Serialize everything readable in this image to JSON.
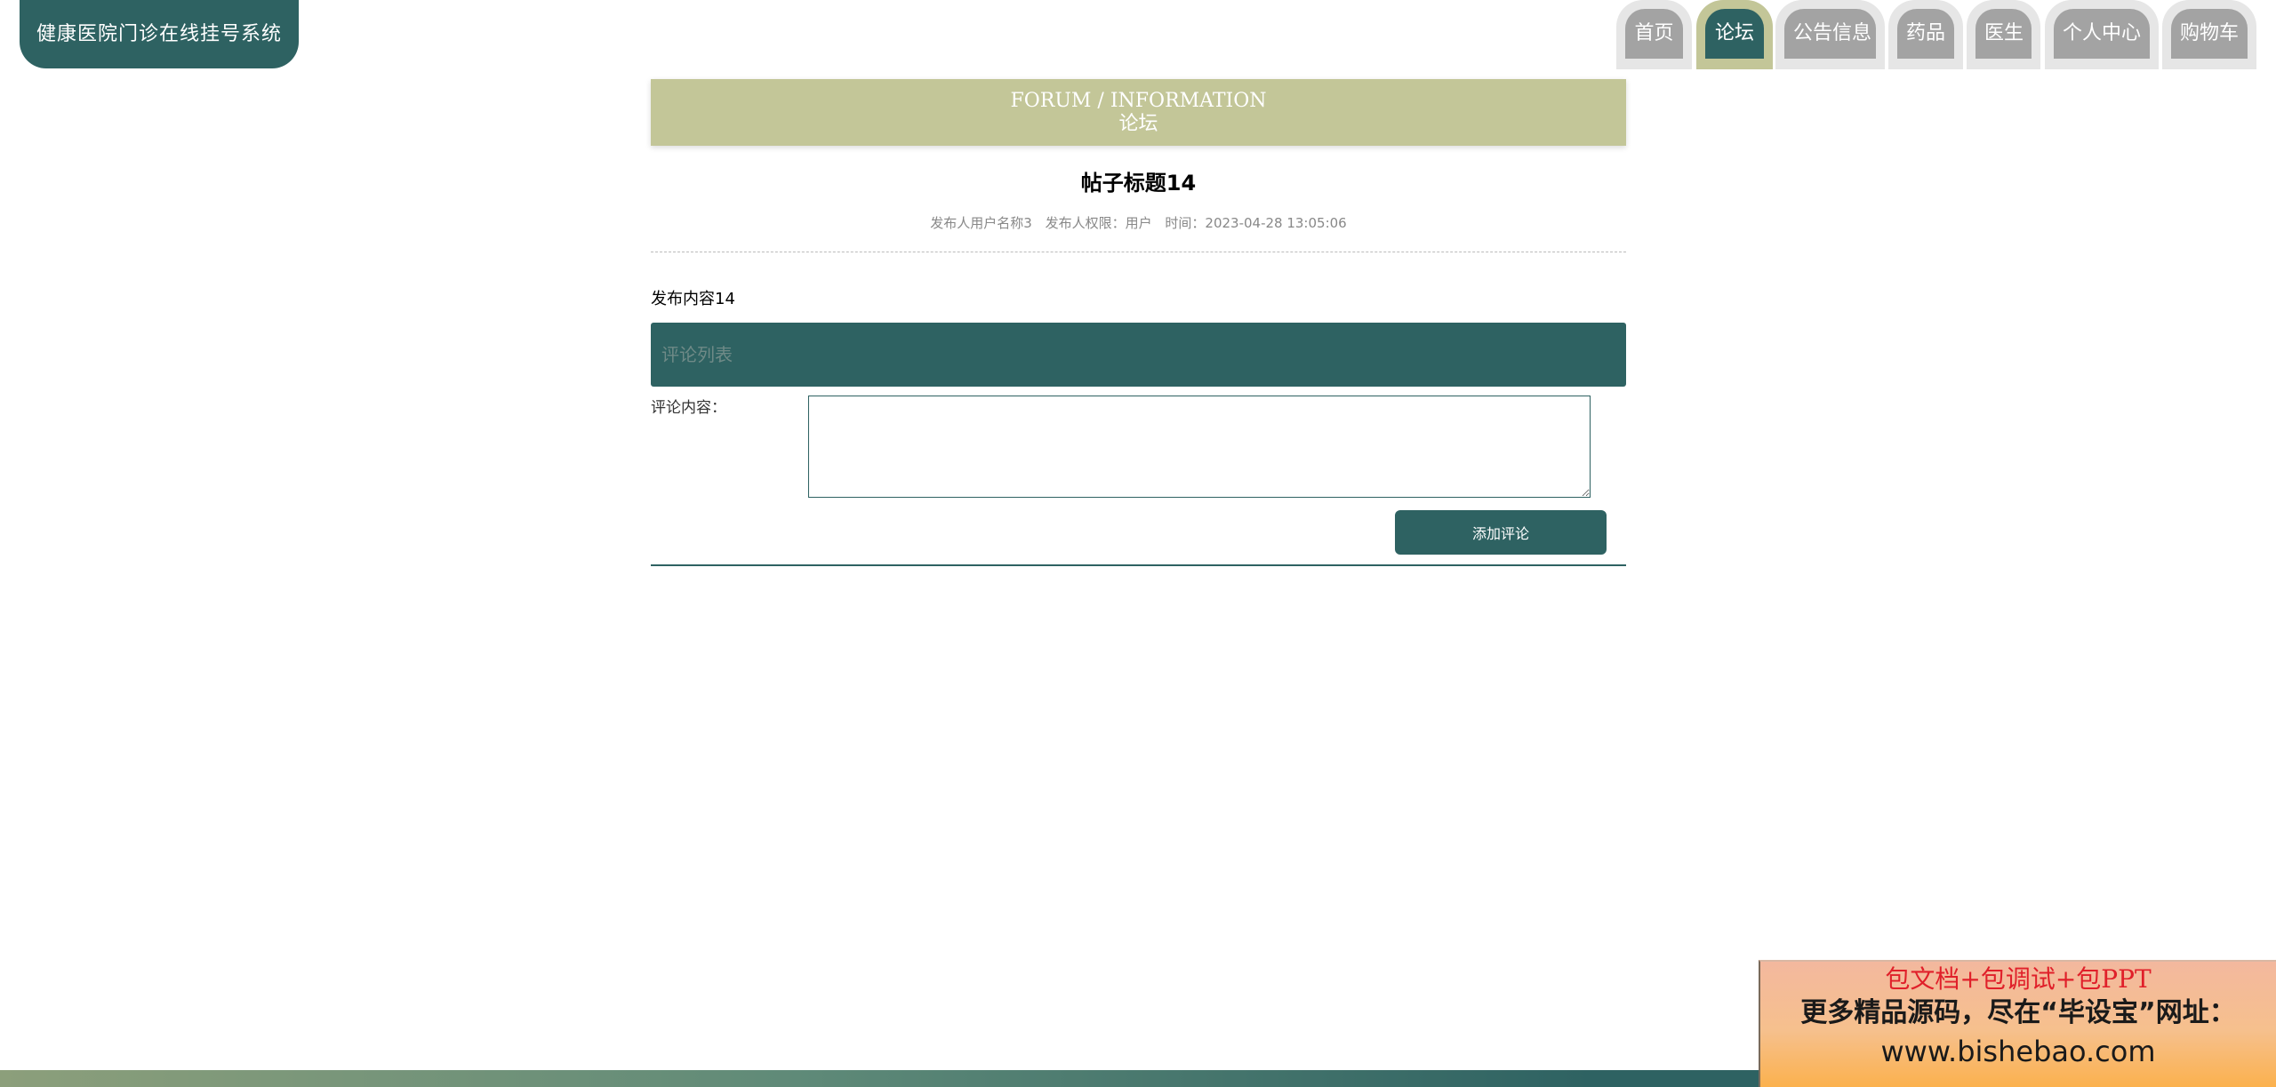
{
  "app": {
    "logo_text": "健康医院门诊在线挂号系统"
  },
  "nav": {
    "items": [
      {
        "label": "首页",
        "active": false
      },
      {
        "label": "论坛",
        "active": true
      },
      {
        "label": "公告信息",
        "active": false
      },
      {
        "label": "药品",
        "active": false
      },
      {
        "label": "医生",
        "active": false
      },
      {
        "label": "个人中心",
        "active": false
      },
      {
        "label": "购物车",
        "active": false
      }
    ]
  },
  "banner": {
    "en": "FORUM / INFORMATION",
    "cn": "论坛"
  },
  "post": {
    "title": "帖子标题14",
    "author": "发布人用户名称3",
    "role": "发布人权限：用户",
    "time": "时间：2023-04-28 13:05:06",
    "content": "发布内容14"
  },
  "comments": {
    "header": "评论列表",
    "label": "评论内容：",
    "textarea_value": "",
    "submit_label": "添加评论"
  },
  "ad": {
    "line1": "包文档+包调试+包PPT",
    "line2": "更多精品源码，尽在“毕设宝”网址：",
    "line3": "www.bishebao.com"
  },
  "colors": {
    "primary": "#2e6262",
    "accent": "#c3c698",
    "nav_inactive": "#a3a3a3",
    "nav_outer": "#e6e6e6"
  }
}
